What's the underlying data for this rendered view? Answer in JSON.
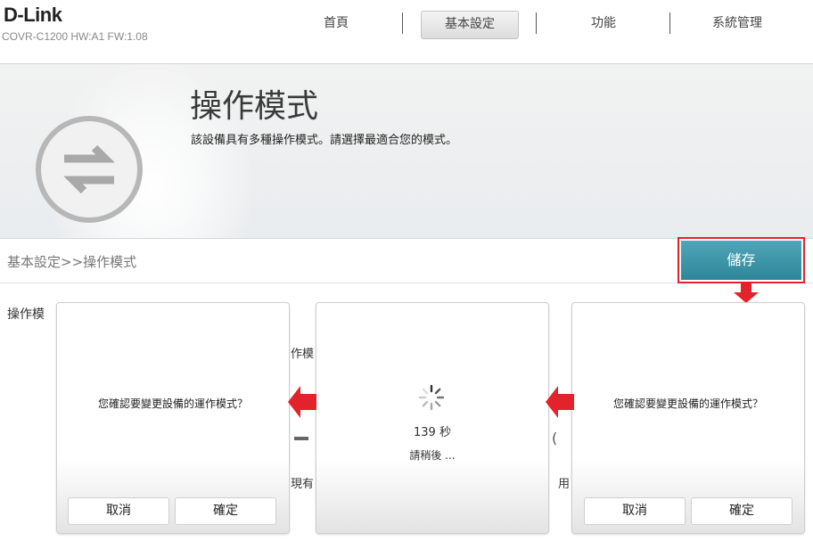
{
  "brand": {
    "logo": "D-Link",
    "model": "COVR-C1200 HW:A1 FW:1.08"
  },
  "nav": {
    "items": [
      {
        "label": "首頁"
      },
      {
        "label": "基本設定"
      },
      {
        "label": "功能"
      },
      {
        "label": "系統管理"
      }
    ],
    "active": "基本設定"
  },
  "banner": {
    "title": "操作模式",
    "description": "該設備具有多種操作模式。請選擇最適合您的模式。",
    "icon": "swap-arrows-icon"
  },
  "breadcrumb": "基本設定>>操作模式",
  "save_label": "儲存",
  "row_label": "操作模",
  "background_fragments": {
    "frag1": "作模",
    "frag2": "現有",
    "frag3": "用"
  },
  "dialogs": {
    "left": {
      "message": "您確認要變更設備的運作模式？",
      "cancel": "取消",
      "confirm": "確定"
    },
    "middle": {
      "countdown": "139 秒",
      "wait": "請稍後 ..."
    },
    "right": {
      "message": "您確認要變更設備的運作模式？",
      "cancel": "取消",
      "confirm": "確定"
    }
  },
  "colors": {
    "accent": "#2f8699",
    "highlight": "#e3232b"
  }
}
